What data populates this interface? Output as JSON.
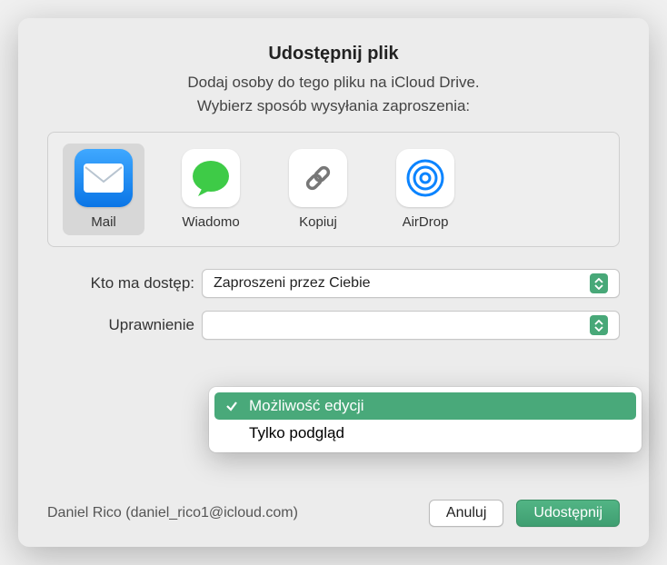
{
  "dialog": {
    "title": "Udostępnij plik",
    "subtitle": "Dodaj osoby do tego pliku na iCloud Drive.",
    "prompt": "Wybierz sposób wysyłania zaproszenia:"
  },
  "share_methods": [
    {
      "id": "mail",
      "label": "Mail",
      "selected": true
    },
    {
      "id": "messages",
      "label": "Wiadomo",
      "selected": false
    },
    {
      "id": "copylink",
      "label": "Kopiuj",
      "selected": false
    },
    {
      "id": "airdrop",
      "label": "AirDrop",
      "selected": false
    }
  ],
  "access": {
    "label": "Kto ma dostęp:",
    "value": "Zaproszeni przez Ciebie"
  },
  "permission": {
    "label": "Uprawnienie",
    "options": [
      {
        "label": "Możliwość edycji",
        "selected": true
      },
      {
        "label": "Tylko podgląd",
        "selected": false
      }
    ]
  },
  "user": "Daniel Rico (daniel_rico1@icloud.com)",
  "buttons": {
    "cancel": "Anuluj",
    "share": "Udostępnij"
  }
}
